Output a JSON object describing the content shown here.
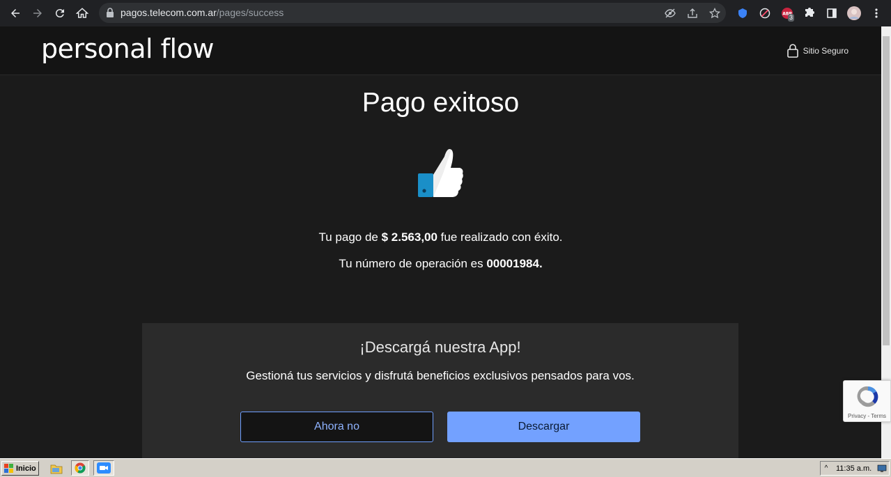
{
  "browser": {
    "url_host": "pagos.telecom.com.ar",
    "url_path": "/pages/success",
    "extension_badge": "3"
  },
  "header": {
    "logo": "personal flow",
    "secure_label": "Sitio Seguro"
  },
  "main": {
    "title": "Pago exitoso",
    "payment_prefix": "Tu pago de ",
    "payment_amount": "$ 2.563,00",
    "payment_suffix": " fue realizado con éxito.",
    "operation_prefix": "Tu número de operación es ",
    "operation_number": "00001984",
    "operation_suffix": "."
  },
  "app_promo": {
    "title": "¡Descargá nuestra App!",
    "subtitle": "Gestioná tus servicios y disfrutá beneficios exclusivos pensados para vos.",
    "dismiss_label": "Ahora no",
    "download_label": "Descargar"
  },
  "recaptcha": {
    "privacy": "Privacy",
    "separator": " - ",
    "terms": "Terms"
  },
  "taskbar": {
    "start_label": "Inicio",
    "clock": "11:35 a.m."
  },
  "colors": {
    "accent": "#73a1ff",
    "background": "#1b1b1b",
    "thumb_blue": "#1a8fc8"
  }
}
